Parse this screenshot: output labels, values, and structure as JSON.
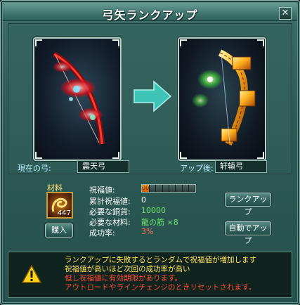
{
  "window": {
    "title": "弓矢ランクアップ",
    "close_symbol": "✕"
  },
  "current": {
    "label": "現在の弓:",
    "name": "震天弓",
    "image": "bow-red-flame"
  },
  "next": {
    "label": "アップ後:",
    "name": "轩辕弓",
    "image": "bow-golden-dragon"
  },
  "material": {
    "label": "材料",
    "count": "447",
    "buy_label": "購入"
  },
  "stats": {
    "blessing_label": "祝福値:",
    "blessing_filled": 1,
    "blessing_total": 8,
    "blessing_value_text": "00",
    "cumulative_label": "累計祝福値:",
    "cumulative_value": "0",
    "silver_label": "必要な銅貨:",
    "silver_value": "10000",
    "materials_label": "必要な材料:",
    "materials_value": "龍の筋 ×8",
    "success_label": "成功率:",
    "success_value": "3%"
  },
  "buttons": {
    "rankup": "ランクアップ",
    "auto_rankup": "自動でアップ"
  },
  "notice": {
    "lines": [
      "ランクアップに失敗するとランダムで祝福値が増加します",
      "祝福値が高いほど次回の成功率が高い",
      "但し祝福値に有効期限があります。",
      "アウトロードやラインチェンジのときリセットされます。"
    ]
  },
  "colors": {
    "accent": "#3fc4b8",
    "label": "#b9f0ff",
    "green": "#6fe46a",
    "red": "#ff6b54",
    "gold": "#ffe45a"
  }
}
